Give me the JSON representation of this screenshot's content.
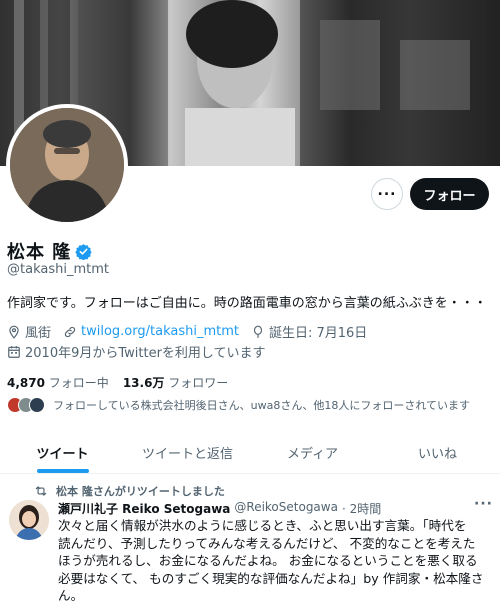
{
  "header": {
    "banner_icon": "banner-photo",
    "avatar_icon": "profile-avatar",
    "more_icon": "ellipsis-icon",
    "follow_label": "フォロー"
  },
  "profile": {
    "name": "松本 隆",
    "verified_icon": "verified-badge-icon",
    "handle": "@takashi_mtmt",
    "bio": "作詞家です。フォローはご自由に。時の路面電車の窓から言葉の紙ふぶきを・・・",
    "location": "風街",
    "website": "twilog.org/takashi_mtmt",
    "birthday": "誕生日: 7月16日",
    "joined": "2010年9月からTwitterを利用しています"
  },
  "stats": {
    "following_count": "4,870",
    "following_label": "フォロー中",
    "followers_count": "13.6万",
    "followers_label": "フォロワー"
  },
  "followed_by": "フォローしている株式会社明後日さん、uwa8さん、他18人にフォローされています",
  "tabs": [
    {
      "label": "ツイート"
    },
    {
      "label": "ツイートと返信"
    },
    {
      "label": "メディア"
    },
    {
      "label": "いいね"
    }
  ],
  "tweet": {
    "retweeted_by": "松本 隆さんがリツイートしました",
    "author": "瀬戸川礼子 Reiko Setogawa",
    "handle": "@ReikoSetogawa",
    "time": "· 2時間",
    "more": "···",
    "lines": [
      "次々と届く情報が洪水のように感じるとき、ふと思い出す言葉。「時代を",
      "読んだり、予測したりってみんな考えるんだけど、 不変的なことを考えた",
      "ほうが売れるし、お金になるんだよね。 お金になるということを悪く取る",
      "必要はなくて、 ものすごく現実的な評価なんだよね」by 作詞家・松本隆さ",
      "ん。"
    ]
  },
  "colors": {
    "accent": "#1d9bf0",
    "text": "#0f1419",
    "muted": "#536471",
    "follow_button": "#0f1419"
  }
}
